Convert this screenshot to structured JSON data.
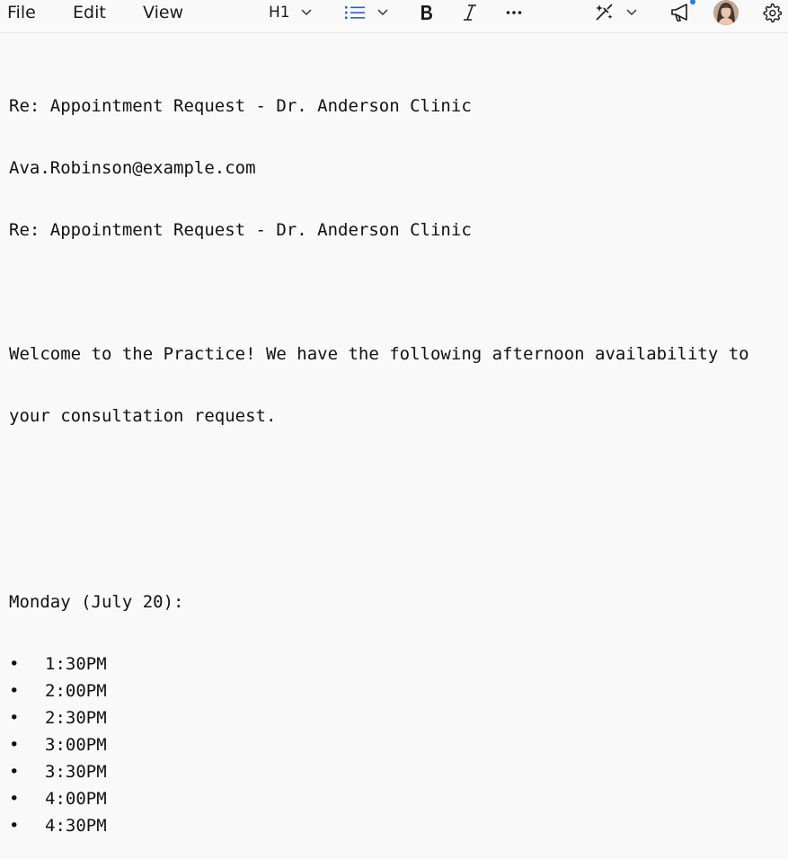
{
  "menu": {
    "file": "File",
    "edit": "Edit",
    "view": "View"
  },
  "toolbar": {
    "heading_label": "H1",
    "icons": [
      "chevron-down-icon",
      "bullet-list-icon",
      "bold-icon",
      "italic-icon",
      "more-icon",
      "copilot-icon",
      "megaphone-icon",
      "avatar",
      "gear-icon"
    ]
  },
  "editor": {
    "subject_line": "Re: Appointment Request - Dr. Anderson Clinic",
    "email": "Ava.Robinson@example.com",
    "subject_line_2": "Re: Appointment Request - Dr. Anderson Clinic",
    "body_line_1": "Welcome to the Practice! We have the following afternoon availability to",
    "body_line_2": "your consultation request.",
    "day_heading": "Monday (July 20):",
    "bullet_char": "•",
    "times": [
      "1:30PM",
      "2:00PM",
      "2:30PM",
      "3:00PM",
      "3:30PM",
      "4:00PM",
      "4:30PM"
    ]
  },
  "colors": {
    "background": "#f9f9f9",
    "accent": "#2b7bd6",
    "text": "#111111"
  }
}
